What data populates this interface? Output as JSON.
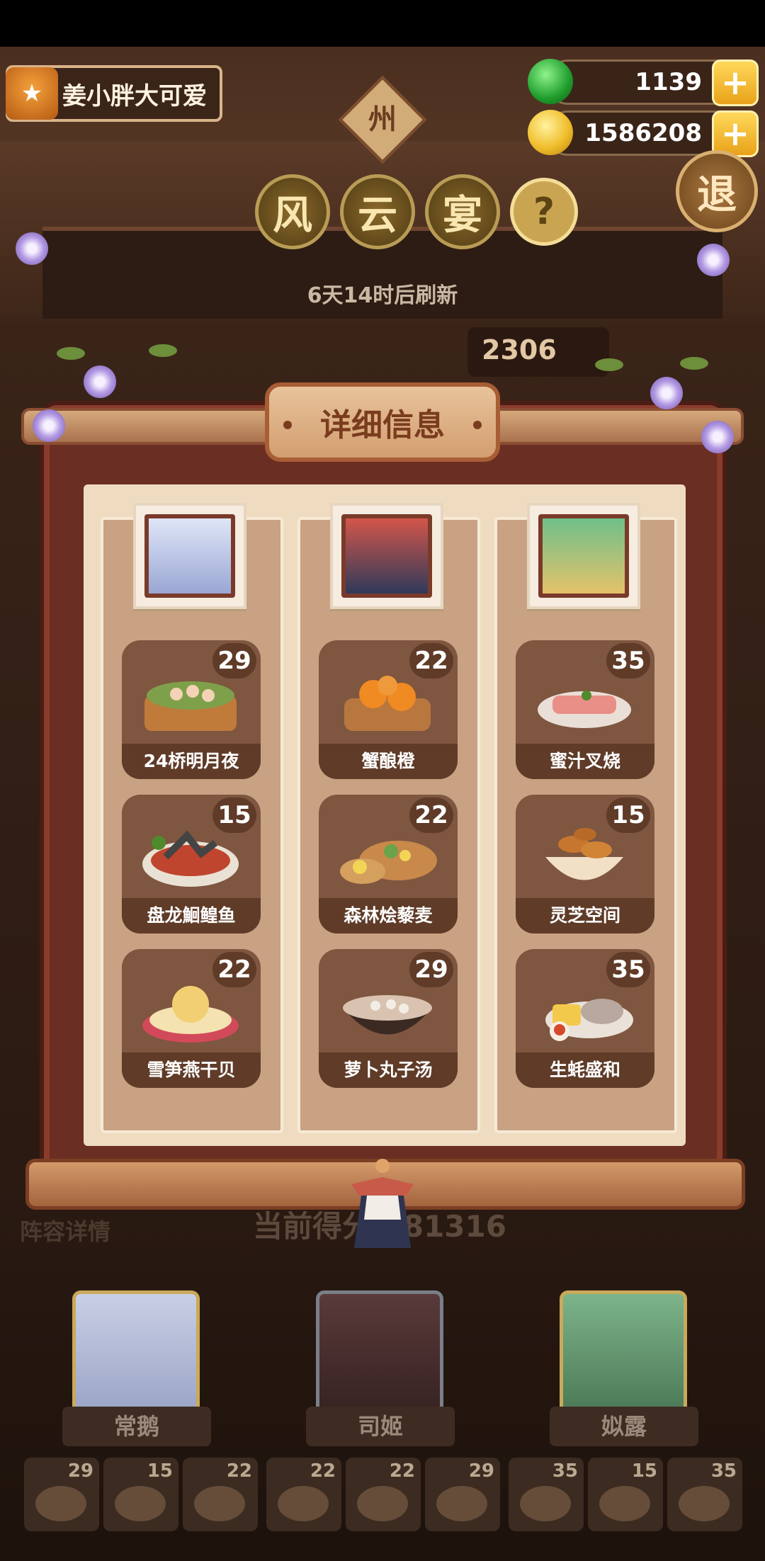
{
  "player": {
    "name": "姜小胖大可爱"
  },
  "resources": {
    "jade": "1139",
    "coins": "1586208"
  },
  "header": {
    "region_char": "州",
    "title_chars": [
      "风",
      "云",
      "宴"
    ],
    "help_label": "?",
    "exit_label": "退",
    "refresh_text": "6天14时后刷新",
    "score_partial": "2306"
  },
  "modal": {
    "title": "详细信息",
    "columns": [
      {
        "dishes": [
          {
            "name": "24桥明月夜",
            "level": "29"
          },
          {
            "name": "盘龙鮰鳇鱼",
            "level": "15"
          },
          {
            "name": "雪笋燕干贝",
            "level": "22"
          }
        ]
      },
      {
        "dishes": [
          {
            "name": "蟹酿橙",
            "level": "22"
          },
          {
            "name": "森林烩藜麦",
            "level": "22"
          },
          {
            "name": "萝卜丸子汤",
            "level": "29"
          }
        ]
      },
      {
        "dishes": [
          {
            "name": "蜜汁叉烧",
            "level": "35"
          },
          {
            "name": "灵芝空间",
            "level": "15"
          },
          {
            "name": "生蚝盛和",
            "level": "35"
          }
        ]
      }
    ]
  },
  "background": {
    "lineup_label": "阵容详情",
    "current_score_prefix": "当前得分",
    "current_score": "281316",
    "characters": [
      "常鹅",
      "司姬",
      "姒露"
    ],
    "mini_levels": [
      "29",
      "15",
      "22",
      "22",
      "22",
      "29",
      "35",
      "15",
      "35"
    ]
  },
  "colors": {
    "accent": "#e8a21a",
    "frame": "#6a2e22",
    "card": "#7f5640"
  }
}
